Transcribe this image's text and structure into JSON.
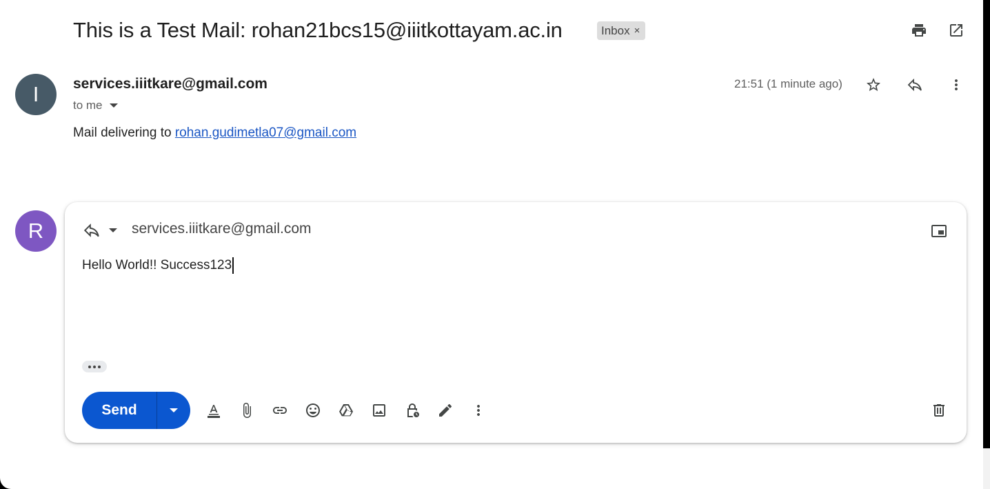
{
  "email": {
    "subject": "This is a Test Mail: rohan21bcs15@iiitkottayam.ac.in",
    "label": "Inbox",
    "label_remove": "×",
    "sender_initial": "I",
    "sender": "services.iiitkare@gmail.com",
    "to_text": "to me",
    "timestamp": "21:51 (1 minute ago)",
    "body_prefix": "Mail delivering to ",
    "body_link": "rohan.gudimetla07@gmail.com"
  },
  "reply": {
    "avatar_initial": "R",
    "to": "services.iiitkare@gmail.com",
    "body": "Hello World!! Success123",
    "send_label": "Send"
  },
  "colors": {
    "send_blue": "#0b57d0",
    "avatar_i": "#475a67",
    "avatar_r": "#7e57c2",
    "link": "#1a56c4"
  },
  "icons": {
    "header": [
      "print-icon",
      "open-in-new-window-icon"
    ],
    "message_actions": [
      "star-icon",
      "reply-icon",
      "more-vert-icon"
    ],
    "composer": [
      "reply-type-icon",
      "pop-out-icon"
    ],
    "toolbar": [
      "format-text-icon",
      "attach-file-icon",
      "insert-link-icon",
      "emoji-icon",
      "google-drive-icon",
      "insert-photo-icon",
      "confidential-mode-icon",
      "signature-icon",
      "more-options-icon",
      "discard-draft-icon"
    ]
  }
}
